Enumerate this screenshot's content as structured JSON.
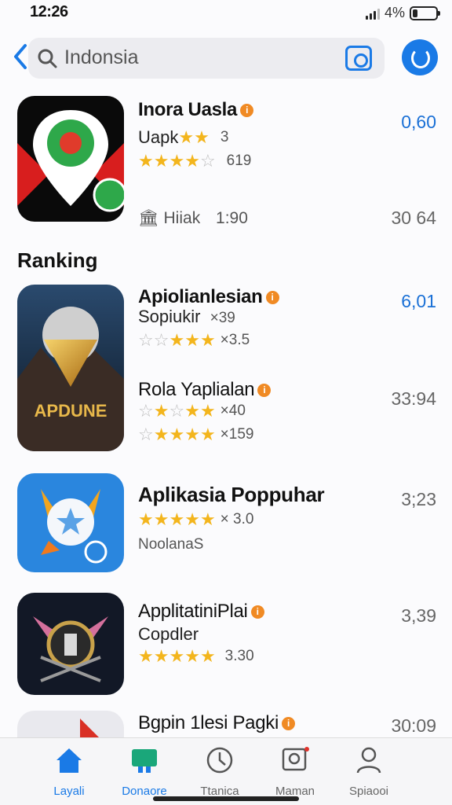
{
  "status": {
    "time": "12:26",
    "battery": "4%"
  },
  "search": {
    "query": "Indonsia"
  },
  "featured": {
    "title": "Inora Uasla",
    "badge": "i",
    "subtitle": "Uapk",
    "subtitle_note": "3",
    "rating_count": "619",
    "meta_label": "Hiiak",
    "meta_value": "1:90",
    "price": "0,60",
    "secondary_value": "30 64"
  },
  "section_title": "Ranking",
  "ranking": [
    {
      "title": "Apiolianlesian",
      "subtitle": "Sopiukir",
      "subtitle_note": "×39",
      "rating_note": "×3.5",
      "price": "6,01",
      "second_title": "Rola Yaplialan",
      "second_rating_note": "×40",
      "third_rating_note": "×159",
      "second_price": "33:94",
      "icon_text": "APDUNE"
    },
    {
      "title": "Aplikasia Poppuhar",
      "rating_note": "× 3.0",
      "developer": "NoolanaS",
      "price": "3;23"
    },
    {
      "title": "ApplitatiniPlai",
      "subtitle": "Copdler",
      "rating_note": "3.30",
      "price": "3,39"
    },
    {
      "title": "Bgpin 1lesi Pagki",
      "price": "30:09"
    }
  ],
  "tabs": [
    {
      "label": "Layali",
      "icon": "home-icon"
    },
    {
      "label": "Donaore",
      "icon": "games-icon"
    },
    {
      "label": "Ttanica",
      "icon": "clock-icon"
    },
    {
      "label": "Maman",
      "icon": "photo-icon"
    },
    {
      "label": "Spiaooi",
      "icon": "person-icon"
    }
  ],
  "colors": {
    "accent": "#1a7ae6",
    "star": "#f3b51d",
    "badge": "#f08a24"
  }
}
